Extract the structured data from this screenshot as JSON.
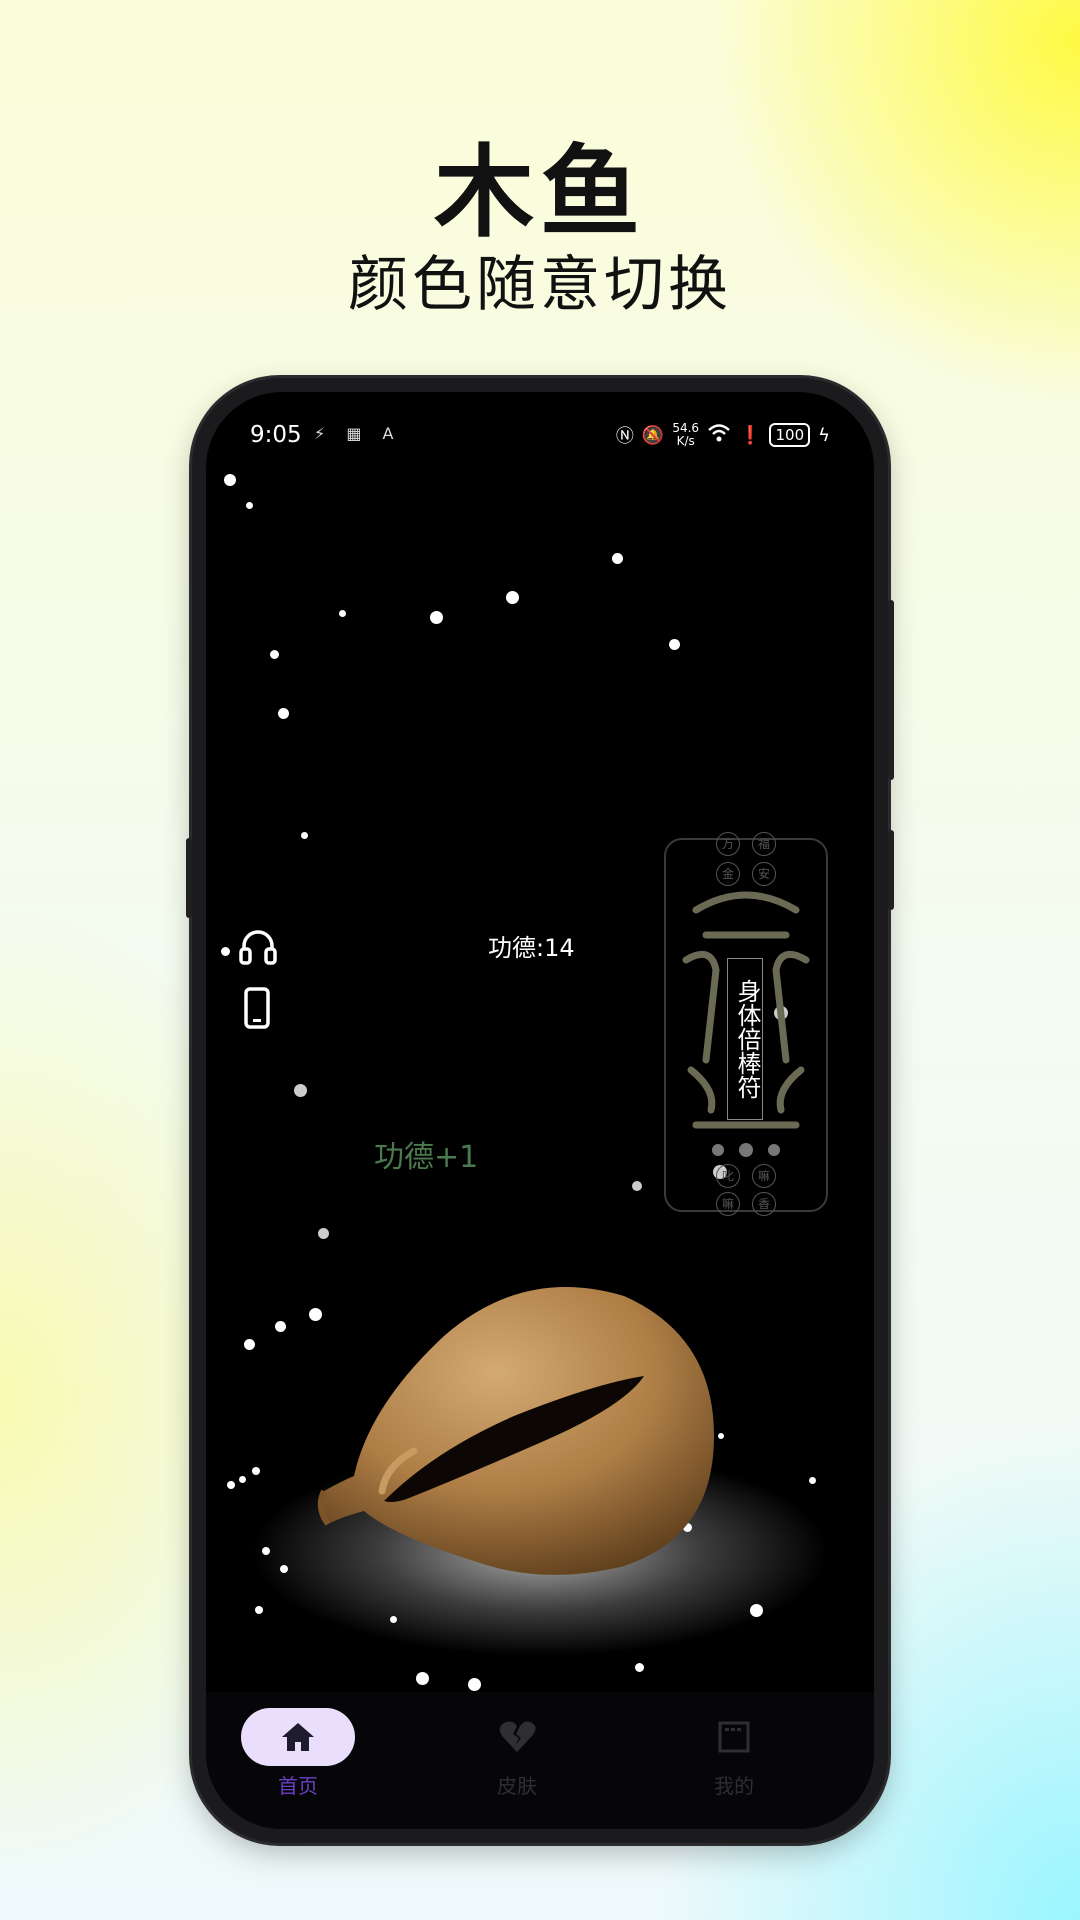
{
  "promo": {
    "title": "木鱼",
    "subtitle": "颜色随意切换"
  },
  "status_bar": {
    "time": "9:05",
    "left_icons": "⚡ ▦ A",
    "speed_value": "54.6",
    "speed_unit": "K/s",
    "battery": "100"
  },
  "app": {
    "merit_counter": "功德:14",
    "merit_popup": "功德+1",
    "side_icons": [
      "headphones-icon",
      "phone-icon"
    ],
    "talisman": {
      "top_chars": [
        "万",
        "福",
        "金",
        "安"
      ],
      "text": "身体倍棒符",
      "bottom_chars": [
        "叱",
        "嘛",
        "嘛",
        "香"
      ]
    }
  },
  "nav": {
    "items": [
      {
        "label": "首页",
        "icon": "home-icon",
        "active": true
      },
      {
        "label": "皮肤",
        "icon": "broken-heart-icon",
        "active": false
      },
      {
        "label": "我的",
        "icon": "window-icon",
        "active": false
      }
    ]
  },
  "colors": {
    "accent": "#6a3fc4",
    "active_pill": "#e9defb",
    "inactive_nav": "#2e2e33",
    "merit_popup": "#4b7a4e"
  }
}
